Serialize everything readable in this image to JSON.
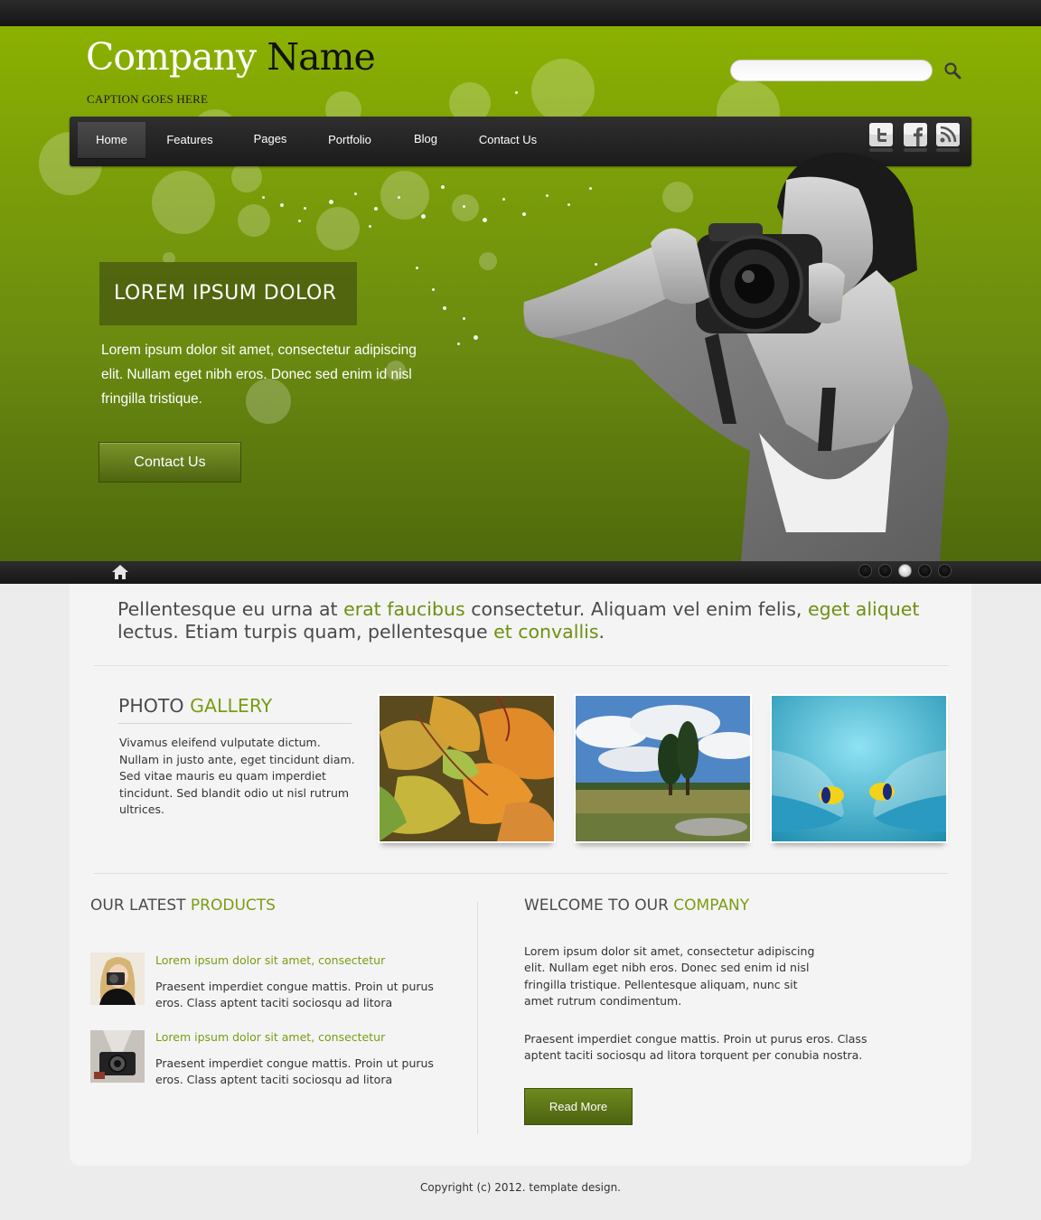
{
  "brand": {
    "name_part1": "Company",
    "name_part2": "Name",
    "caption": "CAPTION GOES HERE"
  },
  "search": {
    "value": "",
    "placeholder": "",
    "icon": "search-icon"
  },
  "nav": {
    "items": [
      {
        "label": "Home",
        "active": true
      },
      {
        "label": "Features",
        "active": false
      },
      {
        "label": "Pages",
        "active": false
      },
      {
        "label": "Portfolio",
        "active": false
      },
      {
        "label": "Blog",
        "active": false
      },
      {
        "label": "Contact Us",
        "active": false
      }
    ]
  },
  "social": {
    "icons": [
      "twitter-icon",
      "facebook-icon",
      "rss-icon"
    ]
  },
  "hero": {
    "title": "LOREM IPSUM DOLOR",
    "text": "Lorem ipsum dolor sit amet, consectetur adipiscing elit. Nullam eget nibh eros. Donec sed enim id nisl fringilla tristique.",
    "button": "Contact Us"
  },
  "slider": {
    "home_icon": "home-icon",
    "pages": 5,
    "active_page": 3
  },
  "intro": {
    "t1": "Pellentesque eu urna at ",
    "h1": "erat faucibus",
    "t2": " consectetur. Aliquam vel enim felis, ",
    "h2": "eget aliquet",
    "t3": " lectus. Etiam turpis quam, pellentesque ",
    "h3": "et convallis",
    "t4": "."
  },
  "gallery": {
    "title_plain": "PHOTO",
    "title_highlight": "GALLERY",
    "text": "Vivamus eleifend vulputate dictum. Nullam in justo ante, eget tincidunt diam. Sed vitae mauris eu quam imperdiet tincidunt. Sed blandit odio ut nisl rutrum ultrices."
  },
  "products": {
    "title_plain": "OUR LATEST",
    "title_highlight": "PRODUCTS",
    "items": [
      {
        "title": "Lorem ipsum dolor sit amet, consectetur",
        "desc": "Praesent imperdiet congue mattis. Proin ut purus eros. Class aptent taciti sociosqu ad litora"
      },
      {
        "title": "Lorem ipsum dolor sit amet, consectetur",
        "desc": "Praesent imperdiet congue mattis. Proin ut purus eros. Class aptent taciti sociosqu ad litora"
      }
    ]
  },
  "welcome": {
    "title_plain": "WELCOME TO OUR",
    "title_highlight": "COMPANY",
    "p1": "Lorem ipsum dolor sit amet, consectetur adipiscing elit. Nullam eget nibh eros. Donec sed enim id nisl fringilla tristique. Pellentesque aliquam, nunc sit amet rutrum condimentum.",
    "p2": "Praesent imperdiet congue mattis. Proin ut purus eros. Class aptent taciti sociosqu ad litora torquent per conubia nostra.",
    "button": "Read More"
  },
  "footer": {
    "copyright": "Copyright (c) 2012. template design."
  },
  "colors": {
    "accent": "#7a9c12",
    "hero_top": "#8bb100",
    "hero_bottom": "#4f6a0c",
    "dark_bar": "#1b1b1b"
  }
}
